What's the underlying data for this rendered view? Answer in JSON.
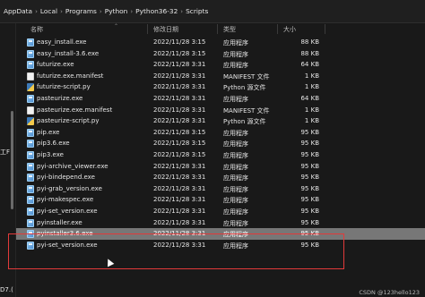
{
  "address_bar": {
    "segments": [
      "AppData",
      "Local",
      "Programs",
      "Python",
      "Python36-32",
      "Scripts"
    ],
    "separator": "›"
  },
  "header": {
    "name": "名称",
    "date": "修改日期",
    "type": "类型",
    "size": "大小"
  },
  "left_pane": {
    "label": "工F",
    "bottom": "D7.("
  },
  "files": [
    {
      "name": "easy_install.exe",
      "date": "2022/11/28 3:15",
      "type": "应用程序",
      "size": "88 KB",
      "icon": "exe-icon"
    },
    {
      "name": "easy_install-3.6.exe",
      "date": "2022/11/28 3:15",
      "type": "应用程序",
      "size": "88 KB",
      "icon": "exe-icon"
    },
    {
      "name": "futurize.exe",
      "date": "2022/11/28 3:31",
      "type": "应用程序",
      "size": "64 KB",
      "icon": "exe-icon"
    },
    {
      "name": "futurize.exe.manifest",
      "date": "2022/11/28 3:31",
      "type": "MANIFEST 文件",
      "size": "1 KB",
      "icon": "file-icon"
    },
    {
      "name": "futurize-script.py",
      "date": "2022/11/28 3:31",
      "type": "Python 源文件",
      "size": "1 KB",
      "icon": "python-file-icon"
    },
    {
      "name": "pasteurize.exe",
      "date": "2022/11/28 3:31",
      "type": "应用程序",
      "size": "64 KB",
      "icon": "exe-icon"
    },
    {
      "name": "pasteurize.exe.manifest",
      "date": "2022/11/28 3:31",
      "type": "MANIFEST 文件",
      "size": "1 KB",
      "icon": "file-icon"
    },
    {
      "name": "pasteurize-script.py",
      "date": "2022/11/28 3:31",
      "type": "Python 源文件",
      "size": "1 KB",
      "icon": "python-file-icon"
    },
    {
      "name": "pip.exe",
      "date": "2022/11/28 3:15",
      "type": "应用程序",
      "size": "95 KB",
      "icon": "exe-icon"
    },
    {
      "name": "pip3.6.exe",
      "date": "2022/11/28 3:15",
      "type": "应用程序",
      "size": "95 KB",
      "icon": "exe-icon"
    },
    {
      "name": "pip3.exe",
      "date": "2022/11/28 3:15",
      "type": "应用程序",
      "size": "95 KB",
      "icon": "exe-icon"
    },
    {
      "name": "pyi-archive_viewer.exe",
      "date": "2022/11/28 3:31",
      "type": "应用程序",
      "size": "95 KB",
      "icon": "exe-icon"
    },
    {
      "name": "pyi-bindepend.exe",
      "date": "2022/11/28 3:31",
      "type": "应用程序",
      "size": "95 KB",
      "icon": "exe-icon"
    },
    {
      "name": "pyi-grab_version.exe",
      "date": "2022/11/28 3:31",
      "type": "应用程序",
      "size": "95 KB",
      "icon": "exe-icon"
    },
    {
      "name": "pyi-makespec.exe",
      "date": "2022/11/28 3:31",
      "type": "应用程序",
      "size": "95 KB",
      "icon": "exe-icon"
    },
    {
      "name": "pyi-set_version.exe",
      "date": "2022/11/28 3:31",
      "type": "应用程序",
      "size": "95 KB",
      "icon": "exe-icon"
    },
    {
      "name": "pyinstaller.exe",
      "date": "2022/11/28 3:31",
      "type": "应用程序",
      "size": "95 KB",
      "icon": "exe-icon"
    },
    {
      "name": "pyinstaller3.6.exe",
      "date": "2022/11/28 3:31",
      "type": "应用程序",
      "size": "95 KB",
      "icon": "exe-icon",
      "selected": true
    },
    {
      "name": "pyi-set_version.exe",
      "date": "2022/11/28 3:31",
      "type": "应用程序",
      "size": "95 KB",
      "icon": "exe-icon"
    }
  ],
  "watermark": "CSDN @123hello123",
  "colors": {
    "highlight": "#e23a3a",
    "selected_row": "#777777",
    "background": "#191919"
  }
}
